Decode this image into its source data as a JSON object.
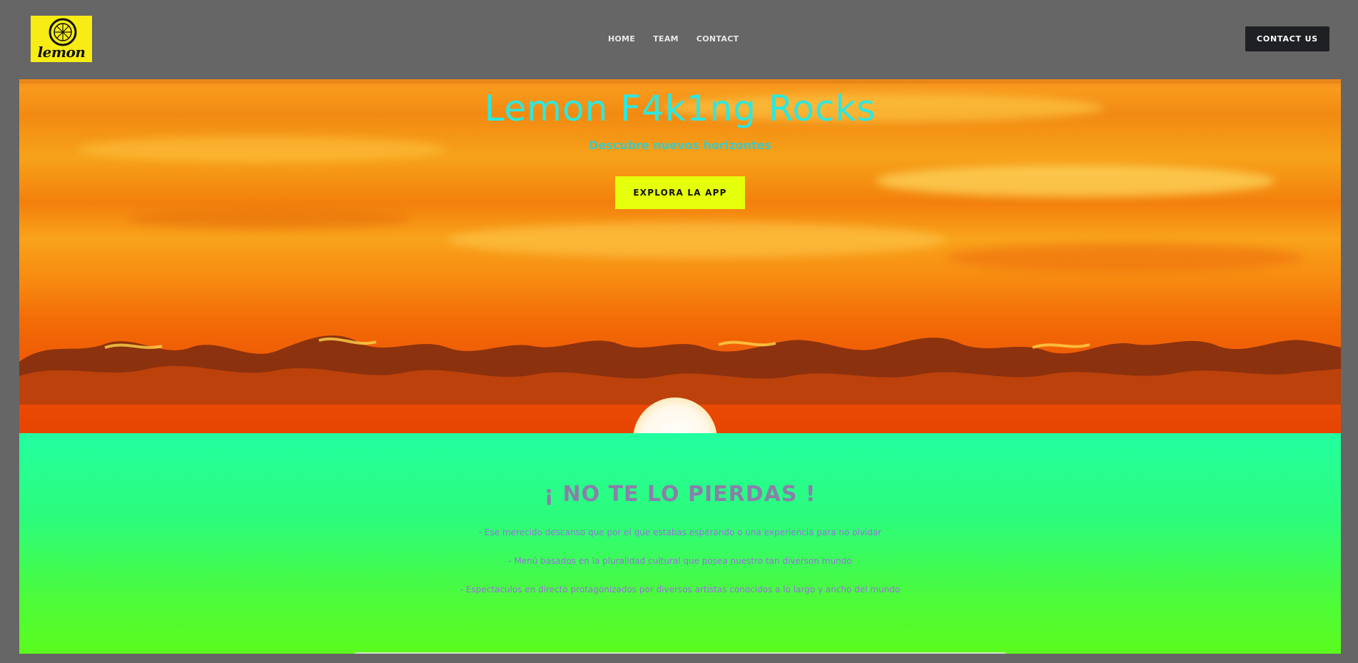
{
  "header": {
    "logo_text": "lemon",
    "nav": [
      {
        "label": "HOME"
      },
      {
        "label": "TEAM"
      },
      {
        "label": "CONTACT"
      }
    ],
    "contact_button": "CONTACT US"
  },
  "hero": {
    "title": "Lemon F4k1ng Rocks",
    "subtitle": "Descubre nuevos horizontes",
    "cta_label": "EXPLORA LA APP"
  },
  "promo": {
    "title": "¡ NO TE LO PIERDAS !",
    "lines": [
      "- Ese merecido descanso que por el que estabas esperando o una experiencia para no olvidar",
      "- Menú basados en la pluralidad cultural que posea nuestro tan diverson mundo",
      "- Espectaculos en directo protagonizados por diversos artistas conocidos a lo largo y ancho del mundo"
    ]
  },
  "colors": {
    "background": "#666666",
    "title_cyan": "#2ce8e0",
    "cta_yellow": "#e6ff0a",
    "promo_title": "#8a7faa",
    "promo_text": "#9b6ee0"
  },
  "icons": [
    "lemon-logo-icon"
  ]
}
